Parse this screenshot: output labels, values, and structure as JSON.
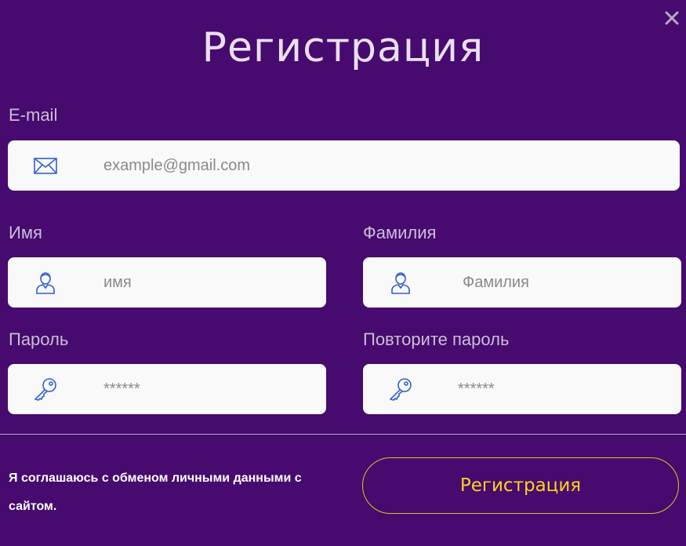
{
  "dialog": {
    "title": "Регистрация",
    "close_icon": "close-icon"
  },
  "form": {
    "email": {
      "label": "E-mail",
      "placeholder": "example@gmail.com",
      "icon": "envelope-icon"
    },
    "first_name": {
      "label": "Имя",
      "placeholder": "имя",
      "icon": "user-icon"
    },
    "last_name": {
      "label": "Фамилия",
      "placeholder": "Фамилия",
      "icon": "user-icon"
    },
    "password": {
      "label": "Пароль",
      "placeholder": "******",
      "icon": "key-icon"
    },
    "password_repeat": {
      "label": "Повторите пароль",
      "placeholder": "******",
      "icon": "key-icon"
    }
  },
  "footer": {
    "agreement_text": "Я соглашаюсь с обменом личными данными с сайтом.",
    "submit_label": "Регистрация"
  },
  "colors": {
    "background": "#470a6f",
    "field_background": "#f9f9f9",
    "icon_blue": "#2f5fd0",
    "button_accent": "#ffd21a",
    "label_text": "#c9bfd6"
  }
}
